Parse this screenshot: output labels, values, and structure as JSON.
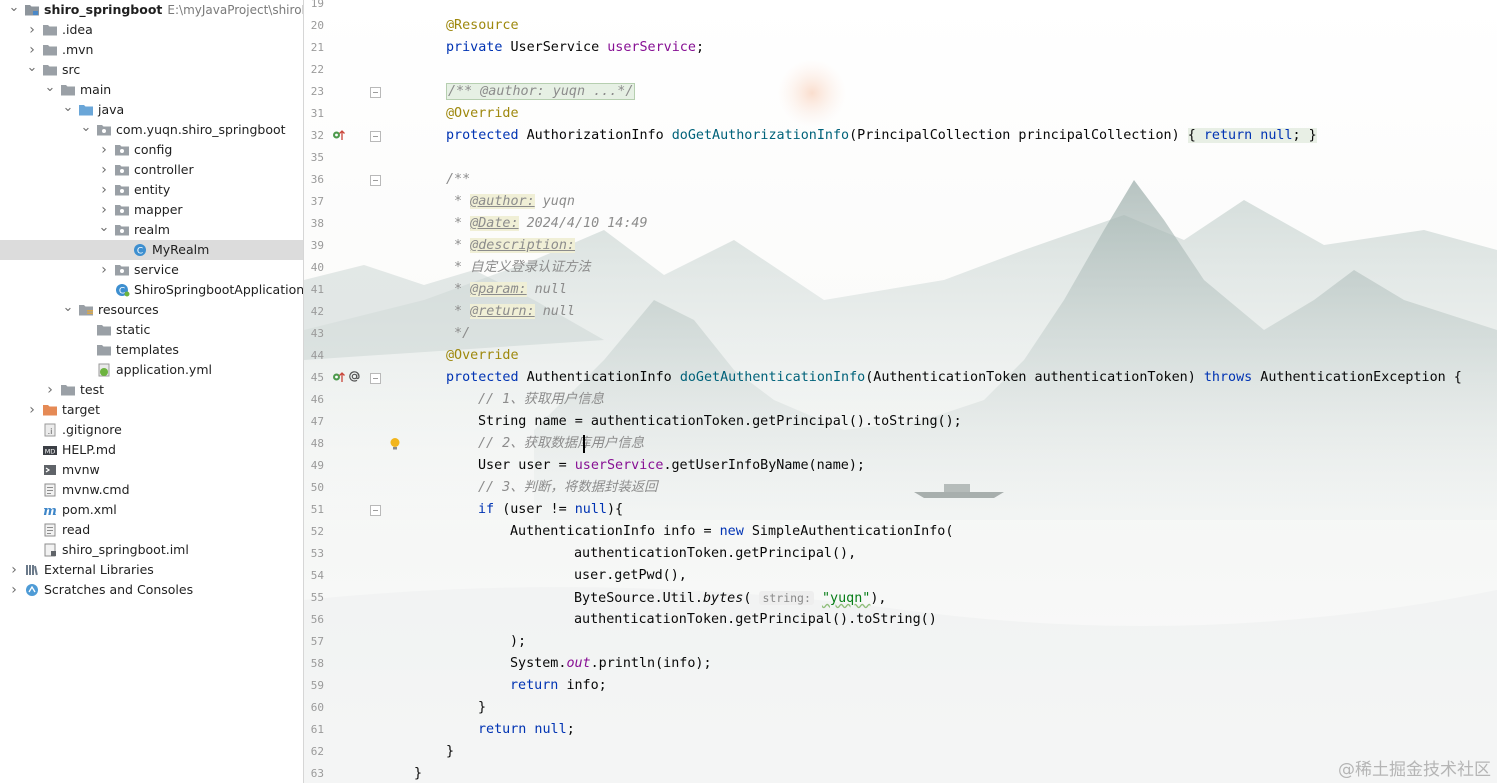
{
  "project_tree": [
    {
      "label": "shiro_springboot",
      "path": "E:\\myJavaProject\\shiroDer",
      "depth": 0,
      "arrow": "down",
      "icon": "module-folder-icon",
      "bold": true
    },
    {
      "label": ".idea",
      "depth": 1,
      "arrow": "right",
      "icon": "folder-icon"
    },
    {
      "label": ".mvn",
      "depth": 1,
      "arrow": "right",
      "icon": "folder-icon"
    },
    {
      "label": "src",
      "depth": 1,
      "arrow": "down",
      "icon": "folder-icon"
    },
    {
      "label": "main",
      "depth": 2,
      "arrow": "down",
      "icon": "folder-icon"
    },
    {
      "label": "java",
      "depth": 3,
      "arrow": "down",
      "icon": "source-folder-icon"
    },
    {
      "label": "com.yuqn.shiro_springboot",
      "depth": 4,
      "arrow": "down",
      "icon": "package-icon"
    },
    {
      "label": "config",
      "depth": 5,
      "arrow": "right",
      "icon": "package-icon"
    },
    {
      "label": "controller",
      "depth": 5,
      "arrow": "right",
      "icon": "package-icon"
    },
    {
      "label": "entity",
      "depth": 5,
      "arrow": "right",
      "icon": "package-icon"
    },
    {
      "label": "mapper",
      "depth": 5,
      "arrow": "right",
      "icon": "package-icon"
    },
    {
      "label": "realm",
      "depth": 5,
      "arrow": "down",
      "icon": "package-icon"
    },
    {
      "label": "MyRealm",
      "depth": 6,
      "arrow": "",
      "icon": "java-class-icon",
      "selected": true
    },
    {
      "label": "service",
      "depth": 5,
      "arrow": "right",
      "icon": "package-icon"
    },
    {
      "label": "ShiroSpringbootApplication",
      "depth": 5,
      "arrow": "",
      "icon": "spring-boot-class-icon"
    },
    {
      "label": "resources",
      "depth": 3,
      "arrow": "down",
      "icon": "resources-folder-icon"
    },
    {
      "label": "static",
      "depth": 4,
      "arrow": "",
      "icon": "folder-icon"
    },
    {
      "label": "templates",
      "depth": 4,
      "arrow": "",
      "icon": "folder-icon"
    },
    {
      "label": "application.yml",
      "depth": 4,
      "arrow": "",
      "icon": "yaml-file-icon"
    },
    {
      "label": "test",
      "depth": 2,
      "arrow": "right",
      "icon": "folder-icon"
    },
    {
      "label": "target",
      "depth": 1,
      "arrow": "right",
      "icon": "excluded-folder-icon"
    },
    {
      "label": ".gitignore",
      "depth": 1,
      "arrow": "",
      "icon": "gitignore-file-icon"
    },
    {
      "label": "HELP.md",
      "depth": 1,
      "arrow": "",
      "icon": "markdown-file-icon"
    },
    {
      "label": "mvnw",
      "depth": 1,
      "arrow": "",
      "icon": "shell-file-icon"
    },
    {
      "label": "mvnw.cmd",
      "depth": 1,
      "arrow": "",
      "icon": "text-file-icon"
    },
    {
      "label": "pom.xml",
      "depth": 1,
      "arrow": "",
      "icon": "maven-file-icon"
    },
    {
      "label": "read",
      "depth": 1,
      "arrow": "",
      "icon": "text-file-icon"
    },
    {
      "label": "shiro_springboot.iml",
      "depth": 1,
      "arrow": "",
      "icon": "iml-file-icon"
    },
    {
      "label": "External Libraries",
      "depth": 0,
      "arrow": "right",
      "icon": "libraries-icon"
    },
    {
      "label": "Scratches and Consoles",
      "depth": 0,
      "arrow": "right",
      "icon": "scratches-icon"
    }
  ],
  "code_lines": [
    {
      "n": "19",
      "indent": 0,
      "tokens": []
    },
    {
      "n": "20",
      "indent": 1,
      "tokens": [
        [
          "ann",
          "@Resource"
        ]
      ]
    },
    {
      "n": "21",
      "indent": 1,
      "tokens": [
        [
          "kw",
          "private "
        ],
        [
          "",
          "UserService "
        ],
        [
          "fld",
          "userService"
        ],
        [
          "",
          ";"
        ]
      ]
    },
    {
      "n": "22",
      "indent": 0,
      "tokens": []
    },
    {
      "n": "23",
      "indent": 1,
      "fold": true,
      "tokens": [
        [
          "doc folded",
          "/** @author: yuqn ...*/"
        ]
      ]
    },
    {
      "n": "31",
      "indent": 1,
      "tokens": [
        [
          "ann",
          "@Override"
        ]
      ]
    },
    {
      "n": "32",
      "indent": 1,
      "fold": true,
      "gutter": "override-icon",
      "tokens": [
        [
          "kw",
          "protected "
        ],
        [
          "",
          "AuthorizationInfo "
        ],
        [
          "mdecl",
          "doGetAuthorizationInfo"
        ],
        [
          "",
          "(PrincipalCollection principalCollection) "
        ],
        [
          "braceblk",
          "{ "
        ],
        [
          "kw braceblk",
          "return null"
        ],
        [
          "braceblk",
          "; }"
        ]
      ]
    },
    {
      "n": "35",
      "indent": 0,
      "tokens": []
    },
    {
      "n": "36",
      "indent": 1,
      "fold": true,
      "tokens": [
        [
          "doc",
          "/**"
        ]
      ]
    },
    {
      "n": "37",
      "indent": 1,
      "tokens": [
        [
          "doc",
          " * "
        ],
        [
          "tag",
          "@author:"
        ],
        [
          "doc",
          " yuqn"
        ]
      ]
    },
    {
      "n": "38",
      "indent": 1,
      "tokens": [
        [
          "doc",
          " * "
        ],
        [
          "tag",
          "@Date:"
        ],
        [
          "doc",
          " 2024/4/10 14:49"
        ]
      ]
    },
    {
      "n": "39",
      "indent": 1,
      "tokens": [
        [
          "doc",
          " * "
        ],
        [
          "tag",
          "@description:"
        ]
      ]
    },
    {
      "n": "40",
      "indent": 1,
      "tokens": [
        [
          "doc",
          " * 自定义登录认证方法"
        ]
      ]
    },
    {
      "n": "41",
      "indent": 1,
      "tokens": [
        [
          "doc",
          " * "
        ],
        [
          "tag",
          "@param:"
        ],
        [
          "doc",
          " null"
        ]
      ]
    },
    {
      "n": "42",
      "indent": 1,
      "tokens": [
        [
          "doc",
          " * "
        ],
        [
          "tag",
          "@return:"
        ],
        [
          "doc",
          " null"
        ]
      ]
    },
    {
      "n": "43",
      "indent": 1,
      "tokens": [
        [
          "doc",
          " */"
        ]
      ]
    },
    {
      "n": "44",
      "indent": 1,
      "tokens": [
        [
          "ann",
          "@Override"
        ]
      ]
    },
    {
      "n": "45",
      "indent": 1,
      "fold": true,
      "gutter": "override-at-icon",
      "tokens": [
        [
          "kw",
          "protected "
        ],
        [
          "",
          "AuthenticationInfo "
        ],
        [
          "mdecl",
          "doGetAuthenticationInfo"
        ],
        [
          "",
          "(AuthenticationToken authenticationToken) "
        ],
        [
          "kw",
          "throws "
        ],
        [
          "",
          "AuthenticationException {"
        ]
      ]
    },
    {
      "n": "46",
      "indent": 2,
      "tokens": [
        [
          "cmt",
          "// 1、获取用户信息"
        ]
      ]
    },
    {
      "n": "47",
      "indent": 2,
      "tokens": [
        [
          "",
          "String name = authenticationToken.getPrincipal().toString();"
        ]
      ]
    },
    {
      "n": "48",
      "indent": 2,
      "gutter": "bulb-icon",
      "caret": true,
      "tokens": [
        [
          "cmt",
          "// 2、获取数据库用户信息"
        ]
      ]
    },
    {
      "n": "49",
      "indent": 2,
      "tokens": [
        [
          "",
          "User user = "
        ],
        [
          "fld",
          "userService"
        ],
        [
          "",
          ".getUserInfoByName(name);"
        ]
      ]
    },
    {
      "n": "50",
      "indent": 2,
      "tokens": [
        [
          "cmt",
          "// 3、判断，将数据封装返回"
        ]
      ]
    },
    {
      "n": "51",
      "indent": 2,
      "fold": true,
      "tokens": [
        [
          "kw",
          "if "
        ],
        [
          "",
          "(user != "
        ],
        [
          "kw",
          "null"
        ],
        [
          "",
          "){"
        ]
      ]
    },
    {
      "n": "52",
      "indent": 3,
      "tokens": [
        [
          "",
          "AuthenticationInfo info = "
        ],
        [
          "kw",
          "new "
        ],
        [
          "",
          "SimpleAuthenticationInfo("
        ]
      ]
    },
    {
      "n": "53",
      "indent": 5,
      "tokens": [
        [
          "",
          "authenticationToken.getPrincipal(),"
        ]
      ]
    },
    {
      "n": "54",
      "indent": 5,
      "tokens": [
        [
          "",
          "user.getPwd(),"
        ]
      ]
    },
    {
      "n": "55",
      "indent": 5,
      "tokens": [
        [
          "",
          "ByteSource.Util."
        ],
        [
          "ital",
          "bytes"
        ],
        [
          "",
          "( "
        ],
        [
          "hint",
          "string:"
        ],
        [
          "",
          " "
        ],
        [
          "str squig",
          "\"yuqn\""
        ],
        [
          "",
          "),"
        ]
      ]
    },
    {
      "n": "56",
      "indent": 5,
      "tokens": [
        [
          "",
          "authenticationToken.getPrincipal().toString()"
        ]
      ]
    },
    {
      "n": "57",
      "indent": 3,
      "tokens": [
        [
          "",
          ");"
        ]
      ]
    },
    {
      "n": "58",
      "indent": 3,
      "tokens": [
        [
          "",
          "System."
        ],
        [
          "static",
          "out"
        ],
        [
          "",
          ".println(info);"
        ]
      ]
    },
    {
      "n": "59",
      "indent": 3,
      "tokens": [
        [
          "kw",
          "return "
        ],
        [
          "",
          "info;"
        ]
      ]
    },
    {
      "n": "60",
      "indent": 2,
      "tokens": [
        [
          "",
          "}"
        ]
      ]
    },
    {
      "n": "61",
      "indent": 2,
      "tokens": [
        [
          "kw",
          "return null"
        ],
        [
          "",
          ";"
        ]
      ]
    },
    {
      "n": "62",
      "indent": 1,
      "tokens": [
        [
          "",
          "}"
        ]
      ]
    },
    {
      "n": "63",
      "indent": 0,
      "tokens": [
        [
          "",
          "}"
        ]
      ]
    }
  ],
  "watermark": "@稀土掘金技术社区"
}
